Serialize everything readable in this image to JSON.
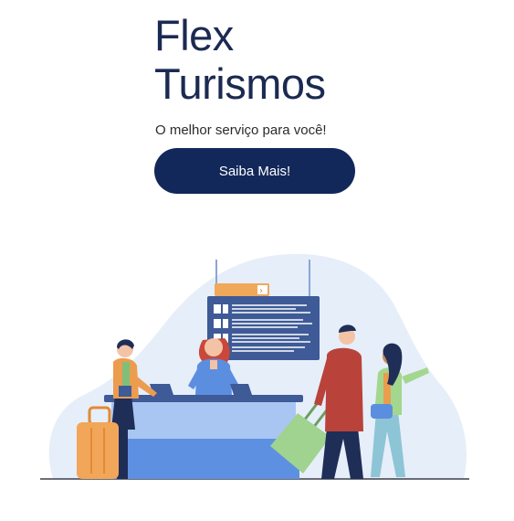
{
  "hero": {
    "title_line1": "Flex",
    "title_line2": "Turismos",
    "tagline": "O melhor serviço para você!",
    "cta_label": "Saiba Mais!"
  },
  "illustration": {
    "icon": "airport-check-in-illustration",
    "board_arrow": "›"
  },
  "colors": {
    "title": "#1b2a52",
    "button": "#13285a",
    "button_text": "#ffffff",
    "board": "#3e5a97",
    "blob": "#e6eef9",
    "desk": "#5e90e2"
  }
}
